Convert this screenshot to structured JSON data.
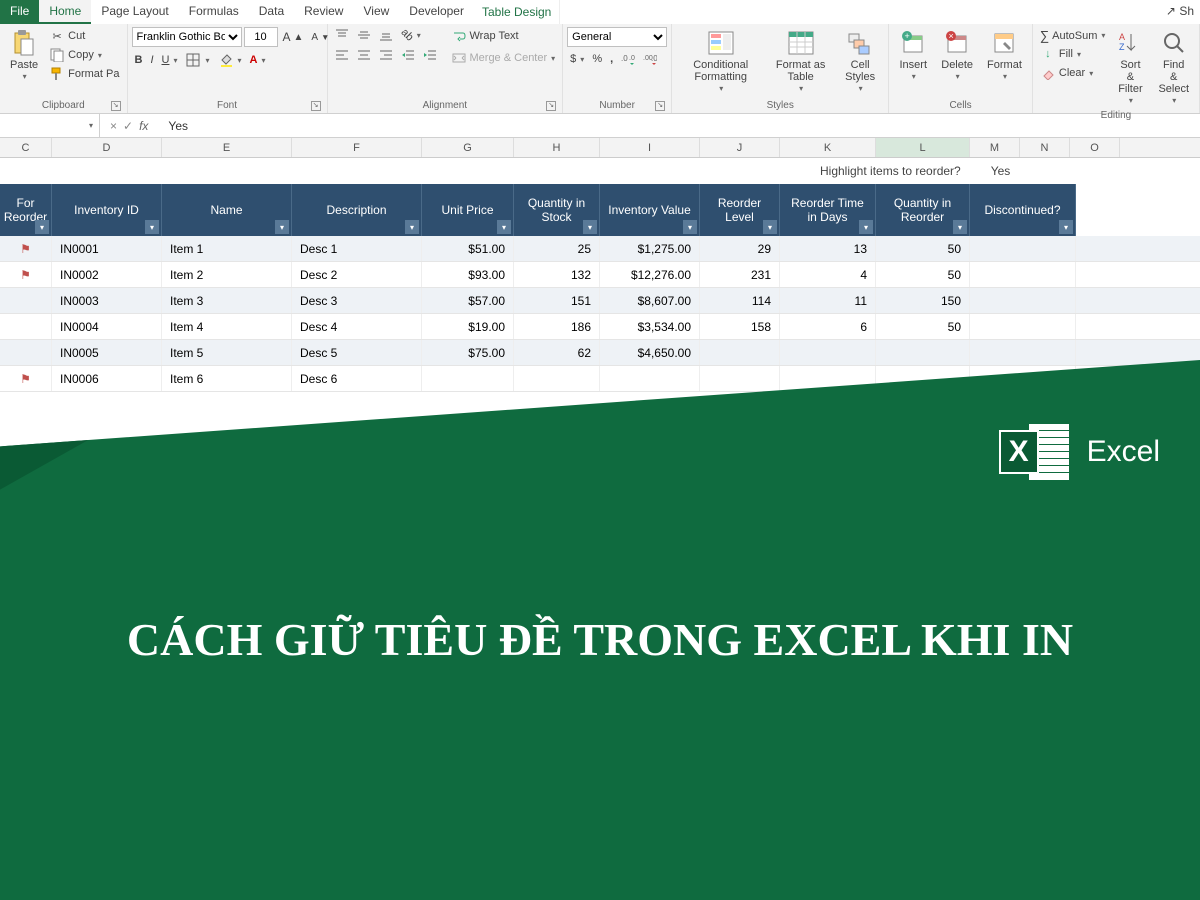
{
  "tabs": {
    "file": "File",
    "home": "Home",
    "page_layout": "Page Layout",
    "formulas": "Formulas",
    "data": "Data",
    "review": "Review",
    "view": "View",
    "developer": "Developer",
    "table_design": "Table Design",
    "share": "Sh"
  },
  "ribbon": {
    "clipboard": {
      "label": "Clipboard",
      "paste": "Paste",
      "cut": "Cut",
      "copy": "Copy",
      "format_painter": "Format Pa"
    },
    "font": {
      "label": "Font",
      "name": "Franklin Gothic Boo",
      "size": "10"
    },
    "alignment": {
      "label": "Alignment",
      "wrap": "Wrap Text",
      "merge": "Merge & Center"
    },
    "number": {
      "label": "Number",
      "format": "General"
    },
    "styles": {
      "label": "Styles",
      "conditional": "Conditional Formatting",
      "format_as_table": "Format as Table",
      "cell_styles": "Cell Styles"
    },
    "cells": {
      "label": "Cells",
      "insert": "Insert",
      "delete": "Delete",
      "format": "Format"
    },
    "editing": {
      "label": "Editing",
      "autosum": "AutoSum",
      "fill": "Fill",
      "clear": "Clear",
      "sort": "Sort & Filter",
      "find": "Find & Select"
    }
  },
  "formula_bar": {
    "value": "Yes"
  },
  "columns": [
    "C",
    "D",
    "E",
    "F",
    "G",
    "H",
    "I",
    "J",
    "K",
    "L",
    "M",
    "N",
    "O"
  ],
  "info": {
    "label": "Highlight items to reorder?",
    "value": "Yes"
  },
  "headers": {
    "flag": "For Reorder",
    "id": "Inventory ID",
    "name": "Name",
    "desc": "Description",
    "price": "Unit Price",
    "stock": "Quantity in Stock",
    "val": "Inventory Value",
    "rl": "Reorder Level",
    "rt": "Reorder Time in Days",
    "qr": "Quantity in Reorder",
    "disc": "Discontinued?"
  },
  "rows": [
    {
      "flag": true,
      "id": "IN0001",
      "name": "Item 1",
      "desc": "Desc 1",
      "price": "$51.00",
      "stock": "25",
      "val": "$1,275.00",
      "rl": "29",
      "rt": "13",
      "qr": "50",
      "disc": ""
    },
    {
      "flag": true,
      "id": "IN0002",
      "name": "Item 2",
      "desc": "Desc 2",
      "price": "$93.00",
      "stock": "132",
      "val": "$12,276.00",
      "rl": "231",
      "rt": "4",
      "qr": "50",
      "disc": ""
    },
    {
      "flag": false,
      "id": "IN0003",
      "name": "Item 3",
      "desc": "Desc 3",
      "price": "$57.00",
      "stock": "151",
      "val": "$8,607.00",
      "rl": "114",
      "rt": "11",
      "qr": "150",
      "disc": ""
    },
    {
      "flag": false,
      "id": "IN0004",
      "name": "Item 4",
      "desc": "Desc 4",
      "price": "$19.00",
      "stock": "186",
      "val": "$3,534.00",
      "rl": "158",
      "rt": "6",
      "qr": "50",
      "disc": ""
    },
    {
      "flag": false,
      "id": "IN0005",
      "name": "Item 5",
      "desc": "Desc 5",
      "price": "$75.00",
      "stock": "62",
      "val": "$4,650.00",
      "rl": "",
      "rt": "",
      "qr": "",
      "disc": ""
    },
    {
      "flag": true,
      "id": "IN0006",
      "name": "Item 6",
      "desc": "Desc 6",
      "price": "",
      "stock": "",
      "val": "",
      "rl": "",
      "rt": "",
      "qr": "",
      "disc": ""
    }
  ],
  "overlay": {
    "brand": "Excel",
    "headline": "CÁCH GIỮ TIÊU ĐỀ TRONG EXCEL KHI IN"
  }
}
